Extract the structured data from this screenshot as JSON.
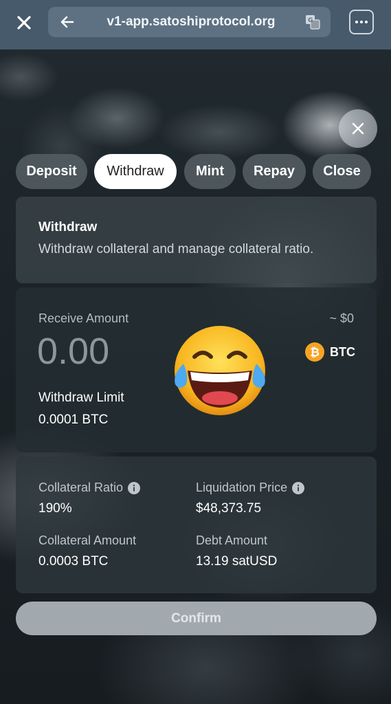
{
  "browser": {
    "url": "v1-app.satoshiprotocol.org",
    "icons": {
      "close": "close-icon",
      "back": "arrow-left-icon",
      "translate": "translate-icon",
      "menu": "more-dots-icon"
    }
  },
  "tabs": [
    {
      "label": "Deposit",
      "active": false
    },
    {
      "label": "Withdraw",
      "active": true
    },
    {
      "label": "Mint",
      "active": false
    },
    {
      "label": "Repay",
      "active": false
    },
    {
      "label": "Close",
      "active": false
    }
  ],
  "header_card": {
    "title": "Withdraw",
    "description": "Withdraw collateral and manage collateral ratio."
  },
  "receive": {
    "label": "Receive Amount",
    "usd_value": "~ $0",
    "amount": "0.00",
    "token": "BTC",
    "limit_label": "Withdraw Limit",
    "limit_value": "0.0001 BTC"
  },
  "stats": {
    "collateral_ratio_label": "Collateral Ratio",
    "collateral_ratio_value": "190%",
    "liquidation_price_label": "Liquidation Price",
    "liquidation_price_value": "$48,373.75",
    "collateral_amount_label": "Collateral Amount",
    "collateral_amount_value": "0.0003 BTC",
    "debt_amount_label": "Debt Amount",
    "debt_amount_value": "13.19 satUSD"
  },
  "confirm_label": "Confirm",
  "colors": {
    "accent_btc": "#f7a325",
    "topbar": "#465a6c"
  }
}
